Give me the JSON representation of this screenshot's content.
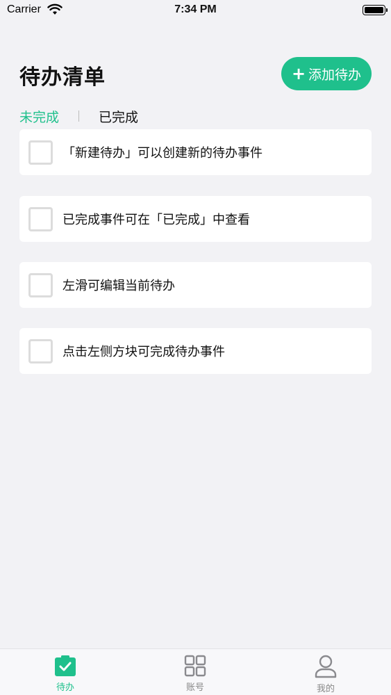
{
  "status_bar": {
    "carrier": "Carrier",
    "time": "7:34 PM"
  },
  "header": {
    "title": "待办清单",
    "add_button_label": "添加待办",
    "add_icon": "plus-icon"
  },
  "tabs": [
    {
      "label": "未完成",
      "active": true
    },
    {
      "label": "已完成",
      "active": false
    }
  ],
  "todos": [
    {
      "text": "「新建待办」可以创建新的待办事件",
      "checked": false
    },
    {
      "text": "已完成事件可在「已完成」中查看",
      "checked": false
    },
    {
      "text": "左滑可编辑当前待办",
      "checked": false
    },
    {
      "text": "点击左侧方块可完成待办事件",
      "checked": false
    }
  ],
  "tabbar": [
    {
      "label": "待办",
      "icon": "todo-check-icon",
      "active": true
    },
    {
      "label": "账号",
      "icon": "grid-icon",
      "active": false
    },
    {
      "label": "我的",
      "icon": "person-icon",
      "active": false
    }
  ],
  "colors": {
    "accent": "#1fc08c",
    "background": "#f2f2f5",
    "card": "#ffffff"
  }
}
